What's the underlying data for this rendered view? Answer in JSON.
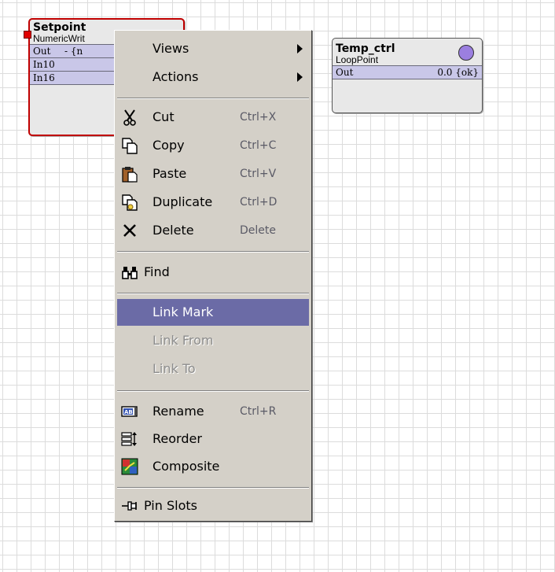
{
  "nodes": {
    "setpoint": {
      "name": "Setpoint",
      "type": "NumericWrit",
      "slots": [
        {
          "name": "Out",
          "value": "- {n"
        },
        {
          "name": "In10",
          "value": ""
        },
        {
          "name": "In16",
          "value": ""
        }
      ],
      "status_color": "#e00000"
    },
    "temp_ctrl": {
      "name": "Temp_ctrl",
      "type": "LoopPoint",
      "slots": [
        {
          "name": "Out",
          "value": "0.0 {ok}"
        }
      ],
      "status_color": "#9b7fe0"
    }
  },
  "context_menu": {
    "views": {
      "label": "Views"
    },
    "actions": {
      "label": "Actions"
    },
    "cut": {
      "label": "Cut",
      "shortcut": "Ctrl+X",
      "icon": "scissors-icon"
    },
    "copy": {
      "label": "Copy",
      "shortcut": "Ctrl+C",
      "icon": "copy-icon"
    },
    "paste": {
      "label": "Paste",
      "shortcut": "Ctrl+V",
      "icon": "clipboard-icon"
    },
    "duplicate": {
      "label": "Duplicate",
      "shortcut": "Ctrl+D",
      "icon": "duplicate-icon"
    },
    "delete": {
      "label": "Delete",
      "shortcut": "Delete",
      "icon": "x-icon"
    },
    "find": {
      "label": "Find",
      "icon": "binoculars-icon"
    },
    "link_mark": {
      "label": "Link Mark"
    },
    "link_from": {
      "label": "Link From"
    },
    "link_to": {
      "label": "Link To"
    },
    "rename": {
      "label": "Rename",
      "shortcut": "Ctrl+R",
      "icon": "rename-icon"
    },
    "reorder": {
      "label": "Reorder",
      "icon": "reorder-icon"
    },
    "composite": {
      "label": "Composite",
      "icon": "composite-icon"
    },
    "pin_slots": {
      "label": "Pin Slots",
      "icon": "pin-icon"
    }
  },
  "colors": {
    "selection": "#6b6ba6",
    "slot_background": "#c9c7e8",
    "menu_background": "#d4d0c8"
  }
}
